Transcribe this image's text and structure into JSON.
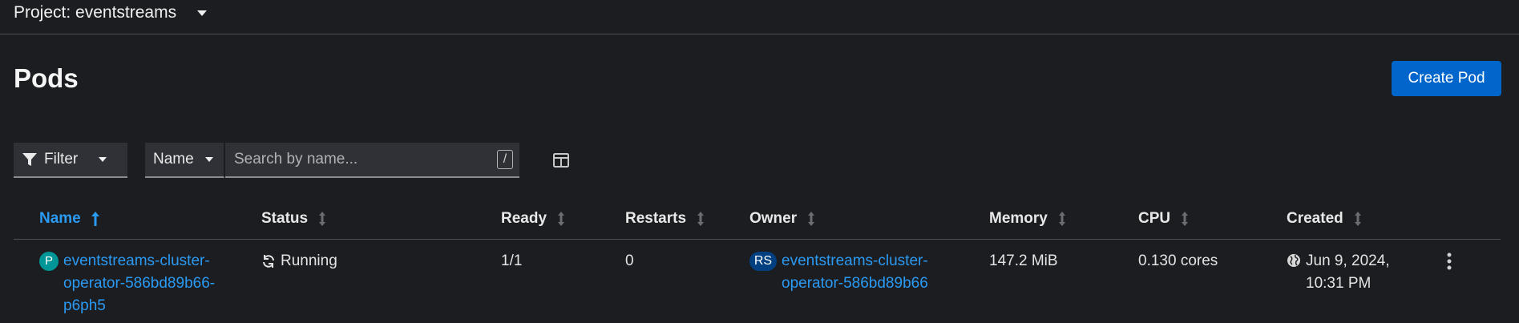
{
  "project": {
    "label": "Project: eventstreams"
  },
  "page": {
    "title": "Pods",
    "create_button": "Create Pod"
  },
  "toolbar": {
    "filter_label": "Filter",
    "attribute_label": "Name",
    "search_placeholder": "Search by name...",
    "search_hint": "/"
  },
  "table": {
    "columns": [
      "Name",
      "Status",
      "Ready",
      "Restarts",
      "Owner",
      "Memory",
      "CPU",
      "Created"
    ],
    "rows": [
      {
        "name_badge": "P",
        "name_line1": "eventstreams-cluster-",
        "name_line2": "operator-586bd89b66-",
        "name_line3": "p6ph5",
        "status": "Running",
        "ready": "1/1",
        "restarts": "0",
        "owner_badge": "RS",
        "owner_line1": "eventstreams-cluster-",
        "owner_line2": "operator-586bd89b66",
        "memory": "147.2 MiB",
        "cpu": "0.130 cores",
        "created_line1": "Jun 9, 2024,",
        "created_line2": "10:31 PM"
      }
    ]
  },
  "colors": {
    "accent": "#0066cc",
    "link": "#2b9af3",
    "pod_badge": "#009596",
    "rs_badge": "#004080",
    "background": "#1b1d21"
  },
  "icons": [
    "caret-down-icon",
    "filter-icon",
    "columns-icon",
    "sort-asc-icon",
    "sort-icon",
    "sync-icon",
    "globe-icon",
    "kebab-icon"
  ]
}
